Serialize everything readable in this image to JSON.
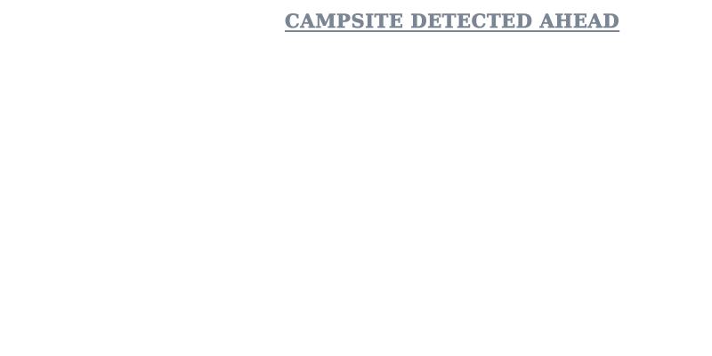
{
  "banner": {
    "text": "CAMPSITE DETECTED AHEAD",
    "color": "#7b8593"
  }
}
